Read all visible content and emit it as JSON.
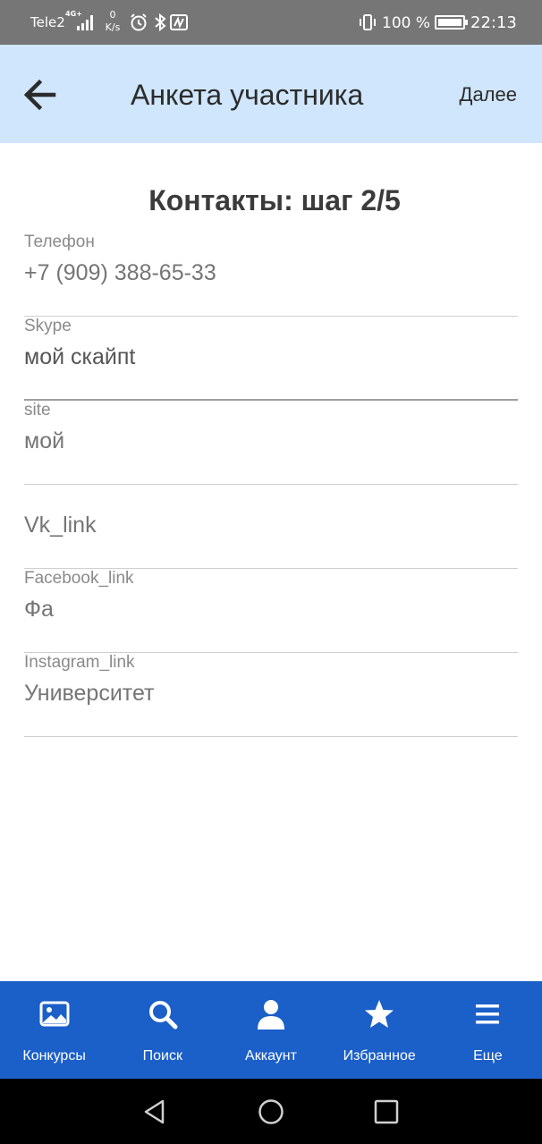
{
  "status_bar": {
    "carrier": "Tele2",
    "network_type": "4G+",
    "speed_value": "0",
    "speed_unit": "K/s",
    "battery_percent": "100 %",
    "battery_level": 1.0,
    "time": "22:13",
    "icons": [
      "signal-icon",
      "alarm-icon",
      "bluetooth-icon",
      "nfc-icon",
      "vibrate-icon",
      "battery-icon"
    ]
  },
  "app_bar": {
    "title": "Анкета участника",
    "next_label": "Далее",
    "background": "#cfe6fc"
  },
  "form": {
    "heading": "Контакты: шаг 2/5",
    "fields": [
      {
        "label": "Телефон",
        "value": "+7 (909) 388-65-33"
      },
      {
        "label": "Skype",
        "value": "мой скайпt"
      },
      {
        "label": "site",
        "value": "мой"
      },
      {
        "label": "",
        "value": "Vk_link"
      },
      {
        "label": "Facebook_link",
        "value": "Фа"
      },
      {
        "label": "Instagram_link",
        "value": "Университет"
      }
    ]
  },
  "bottom_nav": {
    "background": "#1b5fc9",
    "items": [
      {
        "label": "Конкурсы",
        "icon": "image-icon"
      },
      {
        "label": "Поиск",
        "icon": "search-icon"
      },
      {
        "label": "Аккаунт",
        "icon": "person-icon"
      },
      {
        "label": "Избранное",
        "icon": "star-icon"
      },
      {
        "label": "Еще",
        "icon": "menu-icon"
      }
    ]
  },
  "system_nav": {
    "icons": [
      "back-triangle-icon",
      "home-circle-icon",
      "recents-square-icon"
    ]
  }
}
